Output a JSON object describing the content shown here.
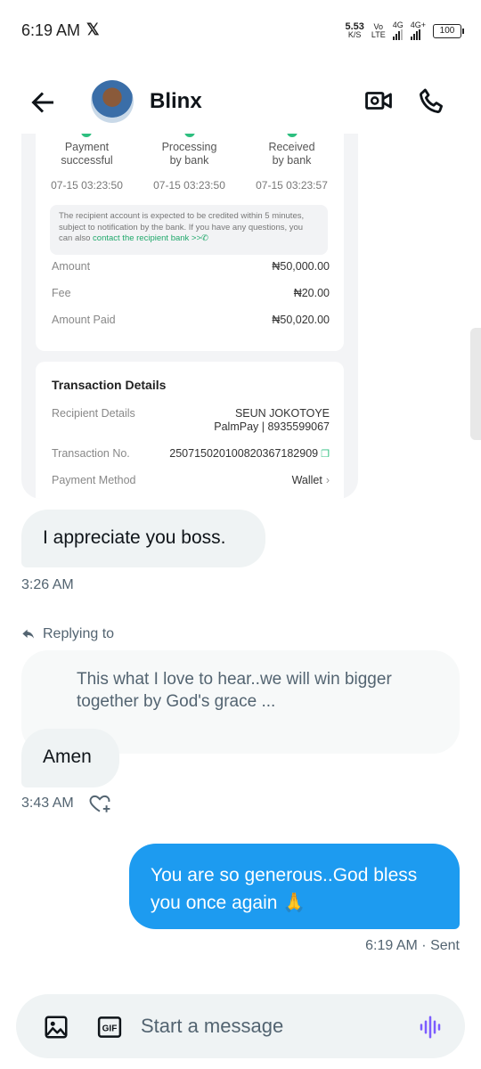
{
  "status_bar": {
    "time": "6:19 AM",
    "x_logo": "𝕏",
    "net_speed_value": "5.53",
    "net_speed_unit": "K/S",
    "net1_top": "Vo",
    "net1_bottom": "LTE",
    "net2_label": "4G",
    "net3_label": "4G+",
    "battery": "100"
  },
  "header": {
    "contact_name": "Blinx",
    "back_icon": "arrow-left-icon",
    "video_icon": "video-camera-icon",
    "call_icon": "phone-icon"
  },
  "receipt": {
    "steps": [
      {
        "label_1": "Payment",
        "label_2": "successful",
        "time": "07-15 03:23:50"
      },
      {
        "label_1": "Processing",
        "label_2": "by bank",
        "time": "07-15 03:23:50"
      },
      {
        "label_1": "Received",
        "label_2": "by bank",
        "time": "07-15 03:23:57"
      }
    ],
    "notice_text": "The recipient account is expected to be credited within 5 minutes, subject to notification by the bank. If you have any questions, you can also ",
    "notice_link": "contact the recipient bank >>",
    "amount_label": "Amount",
    "amount_value": "₦50,000.00",
    "fee_label": "Fee",
    "fee_value": "₦20.00",
    "amount_paid_label": "Amount Paid",
    "amount_paid_value": "₦50,020.00",
    "details_title": "Transaction Details",
    "recipient_label": "Recipient Details",
    "recipient_name": "SEUN JOKOTOYE",
    "recipient_bank": "PalmPay | 8935599067",
    "txn_label": "Transaction No.",
    "txn_value": "250715020100820367182909",
    "method_label": "Payment Method",
    "method_value": "Wallet"
  },
  "messages": {
    "msg1": "I appreciate you boss.",
    "time1": "3:26 AM",
    "replying_to": "Replying to",
    "quoted": "This what I love to hear..we will win bigger together by God's grace ...",
    "msg2": "Amen",
    "time2": "3:43 AM",
    "sent_text": "You are so generous..God bless you once again 🙏",
    "sent_status": "6:19 AM · Sent"
  },
  "composer": {
    "placeholder": "Start a message",
    "gif_label": "GIF"
  },
  "colors": {
    "accent": "#1d9bf0",
    "incoming_bubble": "#eff3f4",
    "secondary_text": "#536471",
    "success_green": "#2dbf7f",
    "voice_purple": "#7c5cff"
  }
}
